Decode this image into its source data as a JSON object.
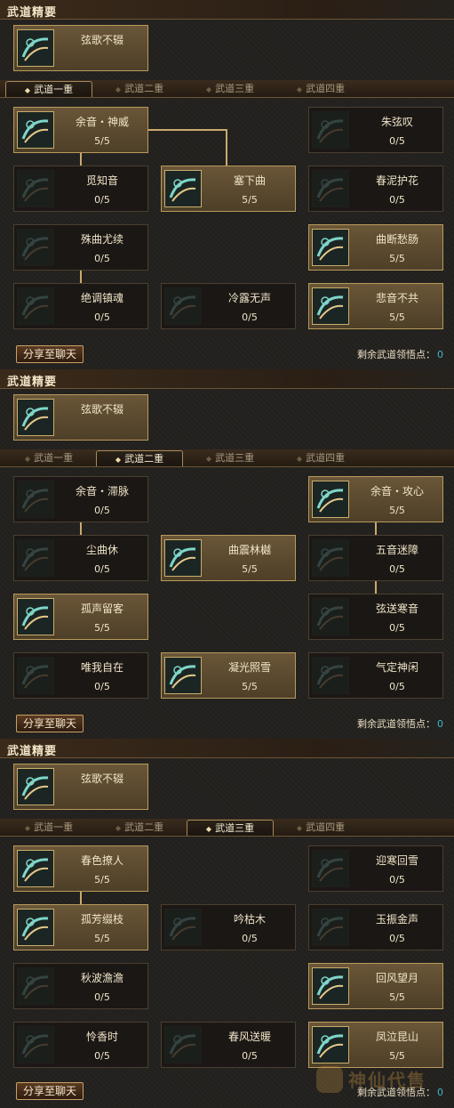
{
  "colors": {
    "background": "#23211e",
    "slot_active_fill": "#5c4a30",
    "slot_active_border": "#b89a5c",
    "connector": "#c9ab6e",
    "points_value": "#3fb6c8"
  },
  "panels": [
    {
      "essence_header": "武道精要",
      "essence": {
        "name": "弦歌不辍",
        "icon": "scroll-spiral-icon"
      },
      "tabs": [
        "武道一重",
        "武道二重",
        "武道三重",
        "武道四重"
      ],
      "active_tab": 0,
      "skills": [
        {
          "name": "余音・神威",
          "level": "5/5",
          "active": true,
          "icon": "sound-wave-icon"
        },
        {
          "name": "朱弦叹",
          "level": "0/5",
          "active": false,
          "icon": "spirit-icon"
        },
        {
          "name": "觅知音",
          "level": "0/5",
          "active": false,
          "icon": "chime-icon"
        },
        {
          "name": "塞下曲",
          "level": "5/5",
          "active": true,
          "icon": "lute-icon"
        },
        {
          "name": "春泥护花",
          "level": "0/5",
          "active": false,
          "icon": "wings-icon"
        },
        {
          "name": "殊曲尤续",
          "level": "0/5",
          "active": false,
          "icon": "wave-icon"
        },
        {
          "name": "曲断愁肠",
          "level": "5/5",
          "active": true,
          "icon": "swirl-icon"
        },
        {
          "name": "绝调镇魂",
          "level": "0/5",
          "active": false,
          "icon": "burst-icon"
        },
        {
          "name": "冷露无声",
          "level": "0/5",
          "active": false,
          "icon": "dew-icon"
        },
        {
          "name": "悲音不共",
          "level": "5/5",
          "active": true,
          "icon": "fire-spiral-icon"
        }
      ],
      "share_label": "分享至聊天",
      "points_label": "剩余武道领悟点：",
      "points_value": "0"
    },
    {
      "essence_header": "武道精要",
      "essence": {
        "name": "弦歌不辍",
        "icon": "scroll-spiral-icon"
      },
      "tabs": [
        "武道一重",
        "武道二重",
        "武道三重",
        "武道四重"
      ],
      "active_tab": 1,
      "skills": [
        {
          "name": "余音・滞脉",
          "level": "0/5",
          "active": false,
          "icon": "sound-wave-icon"
        },
        {
          "name": "余音・攻心",
          "level": "5/5",
          "active": true,
          "icon": "sound-wave-icon"
        },
        {
          "name": "尘曲休",
          "level": "0/5",
          "active": false,
          "icon": "wind-icon"
        },
        {
          "name": "曲震林樾",
          "level": "5/5",
          "active": true,
          "icon": "burst-icon"
        },
        {
          "name": "五音迷障",
          "level": "0/5",
          "active": false,
          "icon": "mist-icon"
        },
        {
          "name": "孤声留客",
          "level": "5/5",
          "active": true,
          "icon": "scroll-icon"
        },
        {
          "name": "弦送寒音",
          "level": "0/5",
          "active": false,
          "icon": "frost-icon"
        },
        {
          "name": "唯我自在",
          "level": "0/5",
          "active": false,
          "icon": "figure-icon"
        },
        {
          "name": "凝光照雪",
          "level": "5/5",
          "active": true,
          "icon": "light-icon"
        },
        {
          "name": "气定神闲",
          "level": "0/5",
          "active": false,
          "icon": "meditate-icon"
        }
      ],
      "share_label": "分享至聊天",
      "points_label": "剩余武道领悟点：",
      "points_value": "0"
    },
    {
      "essence_header": "武道精要",
      "essence": {
        "name": "弦歌不辍",
        "icon": "scroll-spiral-icon"
      },
      "tabs": [
        "武道一重",
        "武道二重",
        "武道三重",
        "武道四重"
      ],
      "active_tab": 2,
      "skills": [
        {
          "name": "春色撩人",
          "level": "5/5",
          "active": true,
          "icon": "sound-wave-icon"
        },
        {
          "name": "迎寒回雪",
          "level": "0/5",
          "active": false,
          "icon": "frost-icon"
        },
        {
          "name": "孤芳缀枝",
          "level": "5/5",
          "active": true,
          "icon": "flower-icon"
        },
        {
          "name": "吟枯木",
          "level": "0/5",
          "active": false,
          "icon": "wave-icon"
        },
        {
          "name": "玉振金声",
          "level": "0/5",
          "active": false,
          "icon": "spirit-icon"
        },
        {
          "name": "秋波澹澹",
          "level": "0/5",
          "active": false,
          "icon": "wind-icon"
        },
        {
          "name": "回风望月",
          "level": "5/5",
          "active": true,
          "icon": "moon-icon"
        },
        {
          "name": "怜香时",
          "level": "0/5",
          "active": false,
          "icon": "swirl-icon"
        },
        {
          "name": "春风送暖",
          "level": "0/5",
          "active": false,
          "icon": "wings-icon"
        },
        {
          "name": "凤泣昆山",
          "level": "5/5",
          "active": true,
          "icon": "fire-spiral-icon"
        }
      ],
      "share_label": "分享至聊天",
      "points_label": "剩余武道领悟点：",
      "points_value": "0"
    }
  ]
}
